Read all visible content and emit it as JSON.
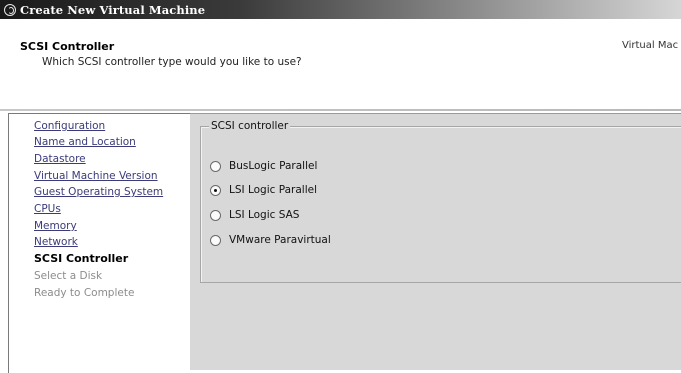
{
  "window": {
    "title": "Create New Virtual Machine",
    "icon": "app-circle-icon"
  },
  "header": {
    "title": "SCSI Controller",
    "subtitle": "Which SCSI controller type would you like to use?",
    "right_text": "Virtual Mac"
  },
  "sidebar": {
    "items": [
      {
        "label": "Configuration",
        "state": "link"
      },
      {
        "label": "Name and Location",
        "state": "link"
      },
      {
        "label": "Datastore",
        "state": "link"
      },
      {
        "label": "Virtual Machine Version",
        "state": "link"
      },
      {
        "label": "Guest Operating System",
        "state": "link"
      },
      {
        "label": "CPUs",
        "state": "link"
      },
      {
        "label": "Memory",
        "state": "link"
      },
      {
        "label": "Network",
        "state": "link"
      },
      {
        "label": "SCSI Controller",
        "state": "current"
      },
      {
        "label": "Select a Disk",
        "state": "disabled"
      },
      {
        "label": "Ready to Complete",
        "state": "disabled"
      }
    ]
  },
  "scsi_group": {
    "legend": "SCSI controller",
    "options": [
      {
        "label": "BusLogic Parallel",
        "selected": false
      },
      {
        "label": "LSI Logic Parallel",
        "selected": true
      },
      {
        "label": "LSI Logic SAS",
        "selected": false
      },
      {
        "label": "VMware Paravirtual",
        "selected": false
      }
    ]
  }
}
